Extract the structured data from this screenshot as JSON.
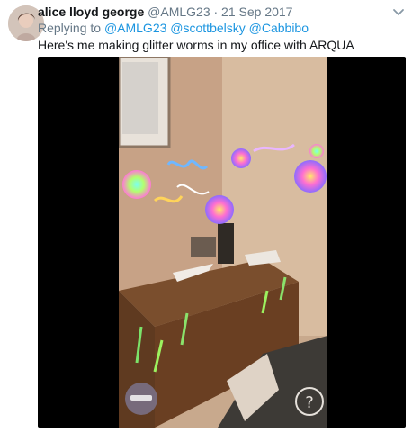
{
  "tweet": {
    "author_name": "alice lloyd george",
    "handle_date": "@AMLG23 · 21 Sep 2017",
    "replying_prefix": "Replying to ",
    "replying_to": "@AMLG23 @scottbelsky @Cabbibo",
    "text": "Here's me making glitter worms in my office with ARQUA"
  },
  "icons": {
    "avatar": "avatar",
    "menu": "chevron-down-icon",
    "help": "question-mark-icon"
  },
  "colors": {
    "link": "#1b95e0",
    "secondary_text": "#657786",
    "media_background": "#000000"
  }
}
